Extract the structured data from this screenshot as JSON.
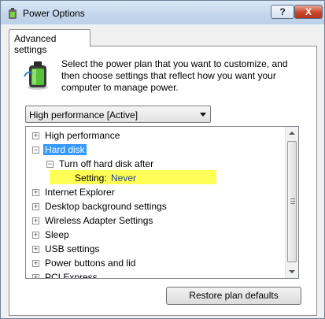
{
  "window": {
    "title": "Power Options",
    "help_label": "?",
    "close_label": "X"
  },
  "tab": {
    "label": "Advanced settings"
  },
  "description": "Select the power plan that you want to customize, and then choose settings that reflect how you want your computer to manage power.",
  "plan_select": {
    "selected": "High performance [Active]"
  },
  "tree": {
    "items": [
      {
        "label": "High performance",
        "expander": "+"
      },
      {
        "label": "Hard disk",
        "expander": "−"
      },
      {
        "label": "Turn off hard disk after",
        "expander": "−"
      },
      {
        "setting_label": "Setting:",
        "setting_value": "Never"
      },
      {
        "label": "Internet Explorer",
        "expander": "+"
      },
      {
        "label": "Desktop background settings",
        "expander": "+"
      },
      {
        "label": "Wireless Adapter Settings",
        "expander": "+"
      },
      {
        "label": "Sleep",
        "expander": "+"
      },
      {
        "label": "USB settings",
        "expander": "+"
      },
      {
        "label": "Power buttons and lid",
        "expander": "+"
      },
      {
        "label": "PCI Express",
        "expander": "+"
      }
    ]
  },
  "buttons": {
    "restore": "Restore plan defaults"
  }
}
